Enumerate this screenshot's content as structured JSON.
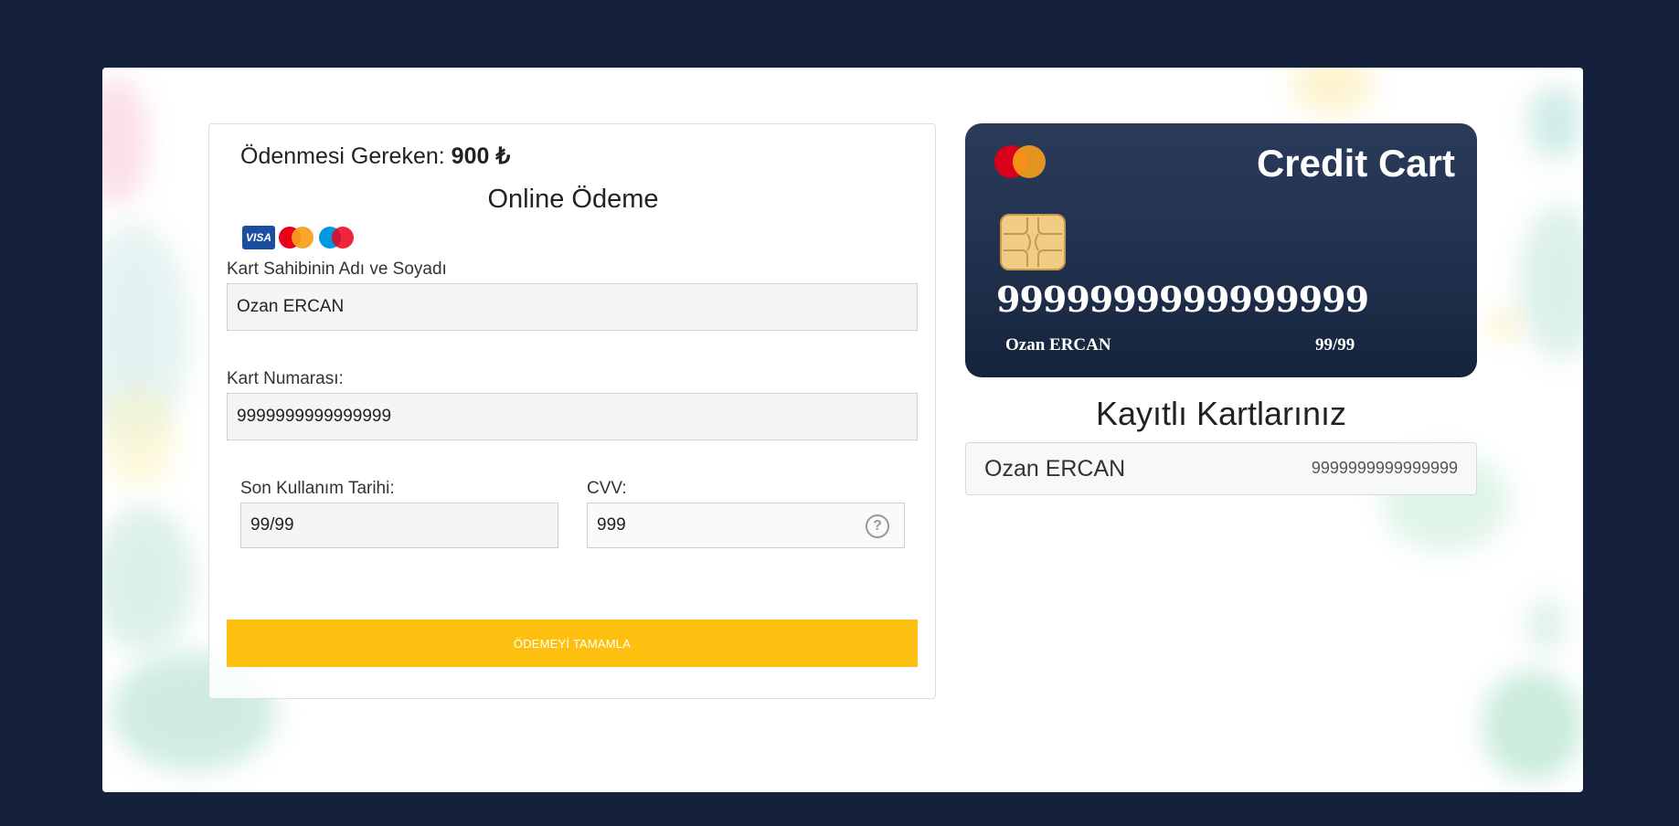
{
  "payment": {
    "amount_label": "Ödenmesi Gereken:",
    "amount_value": "900 ₺",
    "title": "Online Ödeme",
    "brands": {
      "visa": "VISA",
      "mastercard_colors": [
        "#eb001b",
        "#f79e1b"
      ],
      "maestro_colors": [
        "#0099df",
        "#eb001b"
      ]
    }
  },
  "form": {
    "holder_label": "Kart Sahibinin Adı ve Soyadı",
    "holder_value": "Ozan ERCAN",
    "number_label": "Kart Numarası:",
    "number_value": "9999999999999999",
    "expiry_label": "Son Kullanım Tarihi:",
    "expiry_value": "99/99",
    "cvv_label": "CVV:",
    "cvv_value": "999",
    "cvv_help_icon": "question-circle-icon",
    "submit_label": "ÖDEMEYİ TAMAMLA"
  },
  "card_preview": {
    "title": "Credit Cart",
    "number": "9999999999999999",
    "holder": "Ozan ERCAN",
    "expiry": "99/99",
    "logo_icon": "mastercard-logo-icon",
    "chip_icon": "card-chip-icon"
  },
  "saved_cards": {
    "title": "Kayıtlı Kartlarınız",
    "items": [
      {
        "name": "Ozan ERCAN",
        "number": "9999999999999999"
      }
    ]
  },
  "colors": {
    "background": "#15203b",
    "accent_button": "#fdc010",
    "card_top": "#2a3a5a",
    "card_bottom": "#15233c"
  }
}
